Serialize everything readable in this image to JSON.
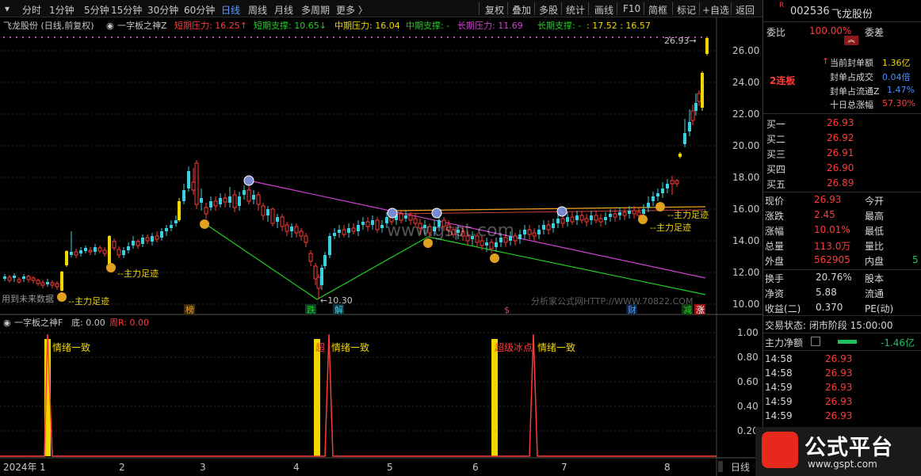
{
  "toolbar": {
    "periods": [
      "分时",
      "1分钟",
      "5分钟",
      "15分钟",
      "30分钟",
      "60分钟",
      "日线",
      "周线",
      "月线",
      "多周期",
      "更多 〉"
    ],
    "active_period": "日线",
    "tools": [
      "复权",
      "叠加",
      "多股",
      "统计",
      "画线",
      "F10",
      "简框",
      "标记",
      "+自选",
      "返回"
    ]
  },
  "main_legend": {
    "stock": "飞龙股份 (日线,前复权)",
    "indicator": "一字板之神Z",
    "s_press_label": "短期压力: 16.25↑",
    "s_supp_label": "短期支撑: 10.65↓",
    "m_press_label": "中期压力: 16.04",
    "m_supp_label": "中期支撑: -",
    "l_press_label": "长期压力: 11.69",
    "l_supp_label": "长期支撑: -",
    "extra": ": 17.52 : 16.57"
  },
  "sub_legend": {
    "indicator": "一字板之神F",
    "bottom": "底: 0.00",
    "week": "周R: 0.00"
  },
  "y_axis": [
    "26.00",
    "24.00",
    "22.00",
    "20.00",
    "18.00",
    "16.00",
    "14.00",
    "12.00",
    "10.00"
  ],
  "sub_y_axis": [
    "1.00",
    "0.80",
    "0.60",
    "0.40",
    "0.20"
  ],
  "x_axis": [
    "2024年",
    "1",
    "2",
    "3",
    "4",
    "5",
    "6",
    "7",
    "8"
  ],
  "x_axis_right_label": "日线",
  "annotations": {
    "high_price": "26.93",
    "low_price": "10.30",
    "main_force": "主力足迹",
    "future_data": "用到未来数据",
    "watermark1": "www.gspt.com",
    "watermark2": "分析家公式网HTTP://WWW.70822.COM",
    "emotion": "情绪一致",
    "ice": "超级冰点",
    "markers": [
      "榜",
      "跌",
      "解",
      "$",
      "财",
      "减",
      "涨"
    ]
  },
  "quote": {
    "code_prefix": "R",
    "code": "002536",
    "name": "飞龙股份",
    "weibi_label": "委比",
    "weibi": "100.00%",
    "weicha_label": "委差",
    "lianban": "2连板",
    "seal_amount_label": "当前封单额",
    "seal_amount": "1.36亿",
    "seal_vs_turnover_label": "封单占成交",
    "seal_vs_turnover": "0.04倍",
    "seal_vs_float_label": "封单占流通Z",
    "seal_vs_float": "1.47%",
    "ten_day_label": "十日总涨幅",
    "ten_day": "57.30%",
    "buys": [
      {
        "label": "买一",
        "price": "26.93"
      },
      {
        "label": "买二",
        "price": "26.92"
      },
      {
        "label": "买三",
        "price": "26.91"
      },
      {
        "label": "买四",
        "price": "26.90"
      },
      {
        "label": "买五",
        "price": "26.89"
      }
    ],
    "stats": [
      {
        "l1": "现价",
        "v1": "26.93",
        "l2": "今开"
      },
      {
        "l1": "涨跌",
        "v1": "2.45",
        "l2": "最高"
      },
      {
        "l1": "涨幅",
        "v1": "10.01%",
        "l2": "最低"
      },
      {
        "l1": "总量",
        "v1": "113.0万",
        "l2": "量比"
      },
      {
        "l1": "外盘",
        "v1": "562905",
        "l2": "内盘",
        "v2": "5"
      }
    ],
    "stats2": [
      {
        "l1": "换手",
        "v1": "20.76%",
        "l2": "股本"
      },
      {
        "l1": "净资",
        "v1": "5.88",
        "l2": "流通"
      },
      {
        "l1": "收益(二)",
        "v1": "0.370",
        "l2": "PE(动)"
      }
    ],
    "trade_state": "交易状态: 闭市阶段 15:00:00",
    "net_flow_label": "主力净额",
    "net_flow": "-1.46亿",
    "ticks": [
      {
        "t": "14:58",
        "p": "26.93"
      },
      {
        "t": "14:58",
        "p": "26.93"
      },
      {
        "t": "14:59",
        "p": "26.93"
      },
      {
        "t": "14:59",
        "p": "26.93"
      },
      {
        "t": "14:59",
        "p": "26.93"
      }
    ]
  },
  "brand": {
    "name": "公式平台",
    "url": "www.gspt.com"
  },
  "colors": {
    "up": "#ff3b3b",
    "down": "#3ad0e0",
    "limit": "#f2d600",
    "resist": "#d040d0",
    "support": "#20d020"
  }
}
